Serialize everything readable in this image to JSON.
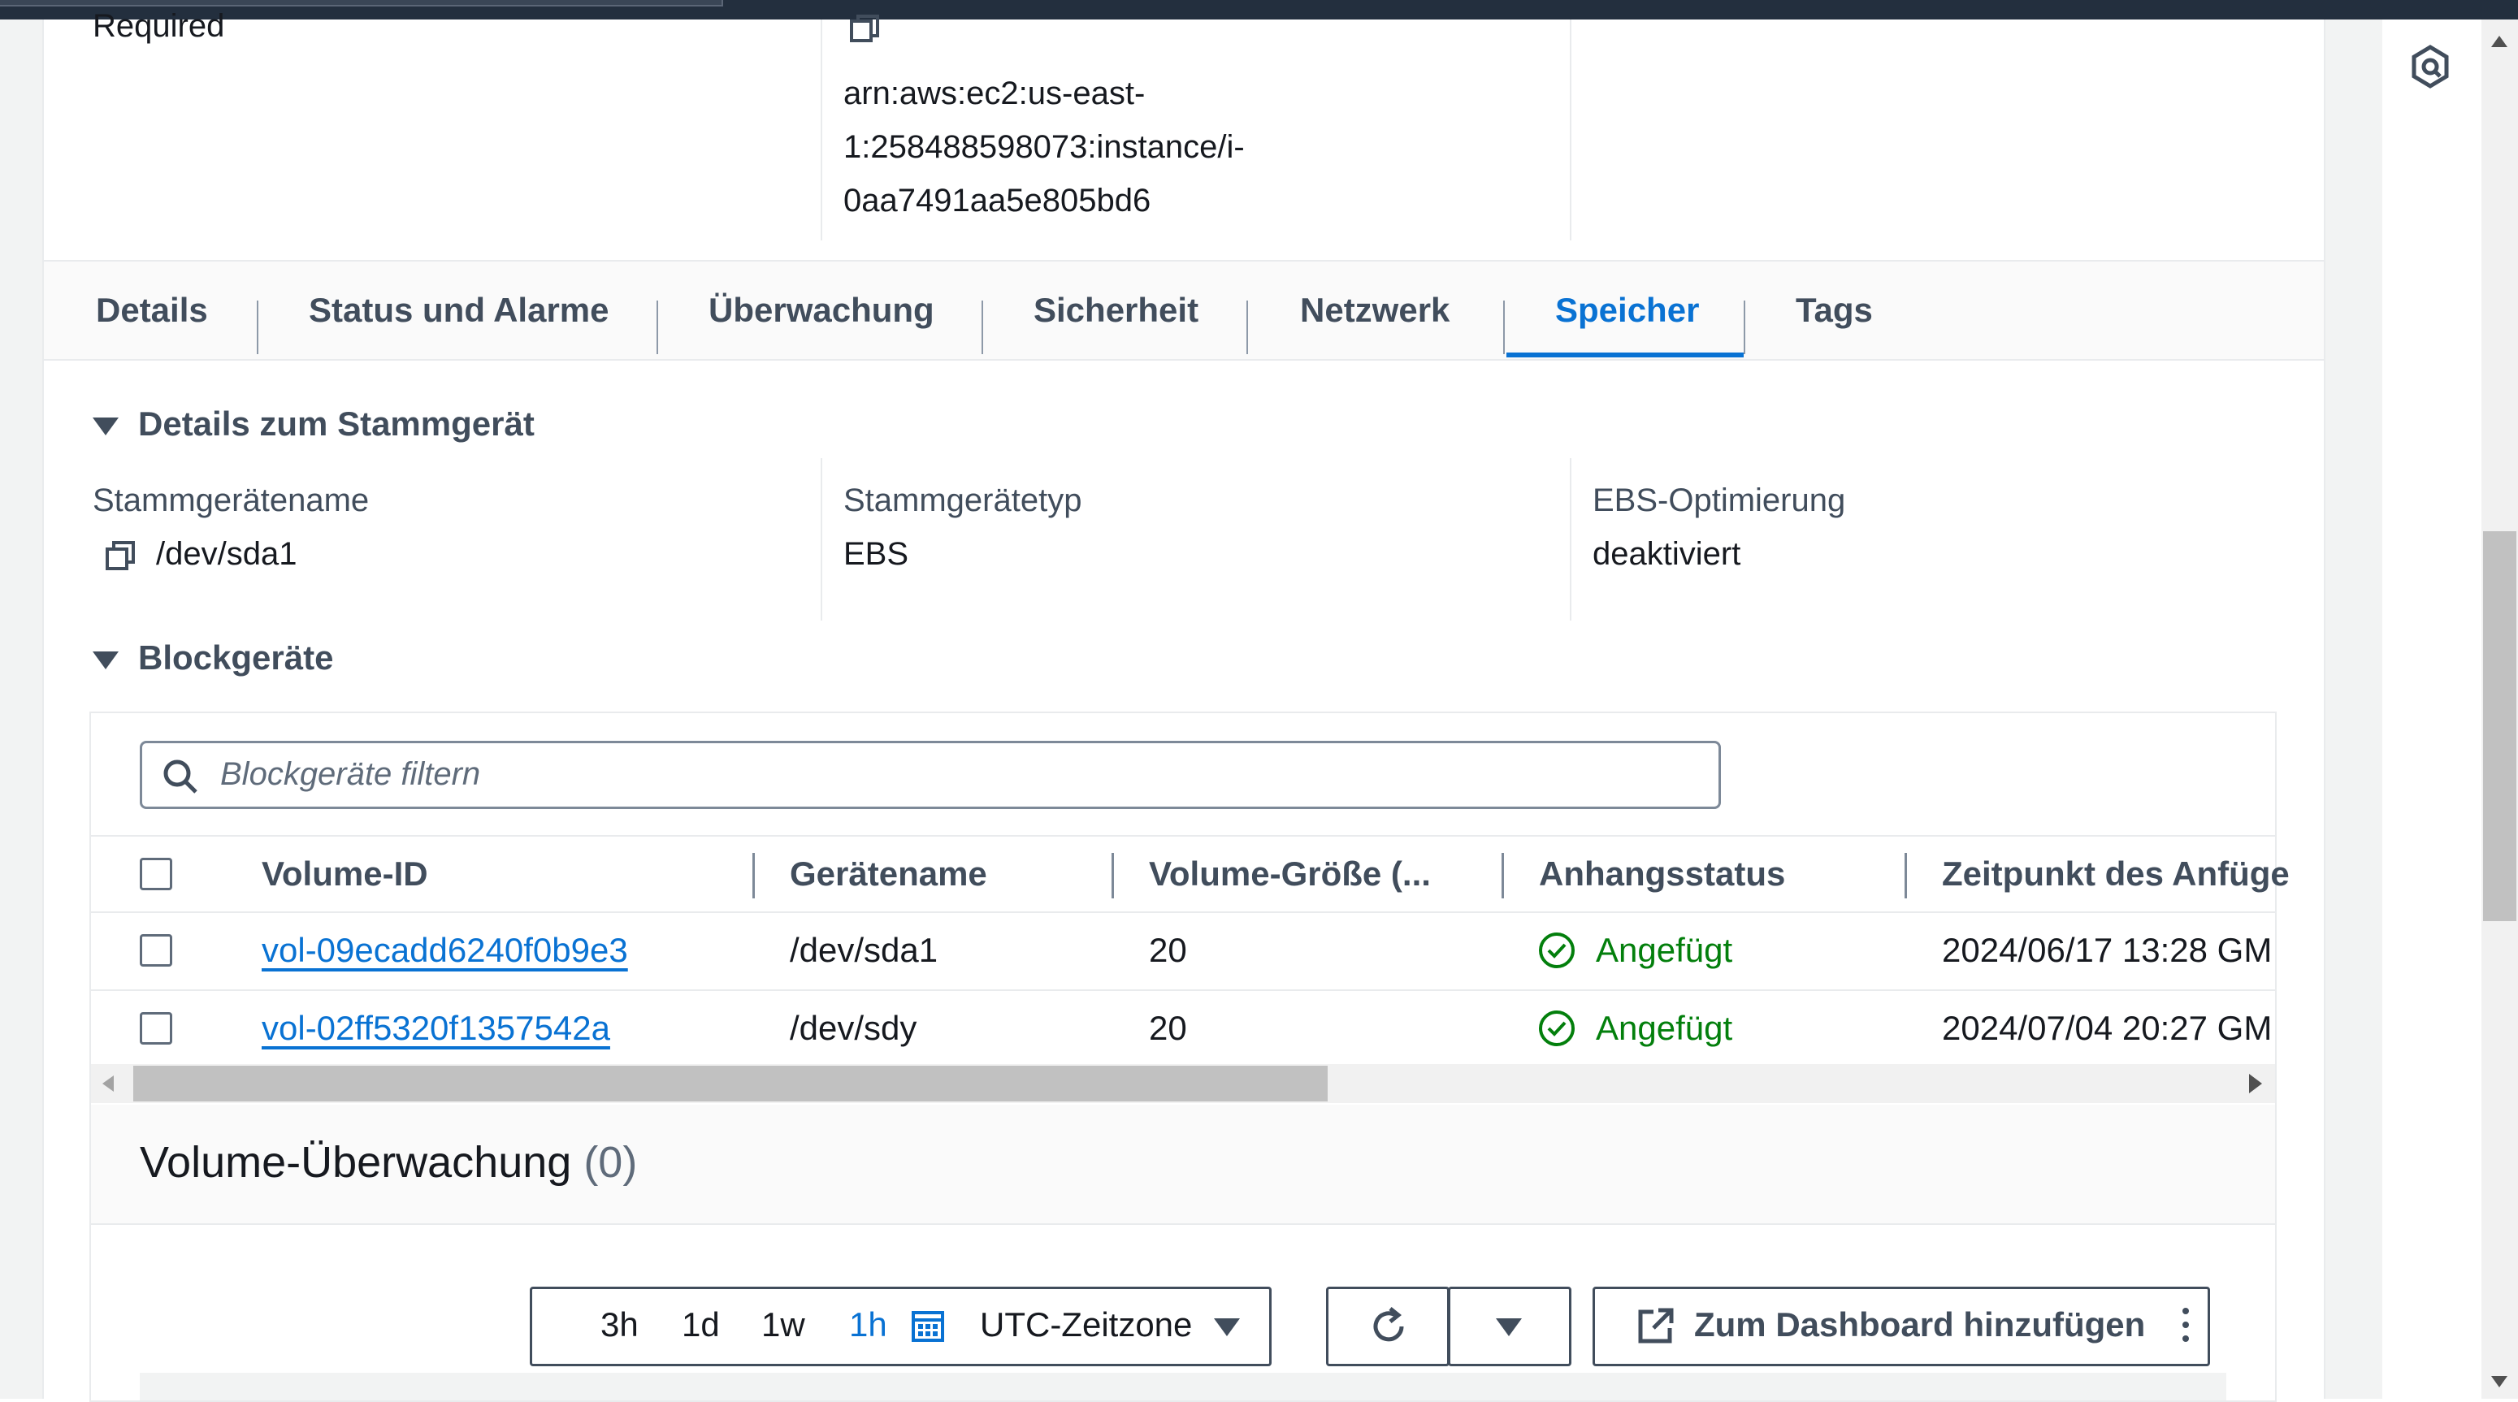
{
  "top": {
    "required_label": "Required",
    "arn_lines": [
      "arn:aws:ec2:us-east-",
      "1:258488598073:instance/i-",
      "0aa7491aa5e805bd6"
    ]
  },
  "tabs": [
    {
      "label": "Details"
    },
    {
      "label": "Status und Alarme"
    },
    {
      "label": "Überwachung"
    },
    {
      "label": "Sicherheit"
    },
    {
      "label": "Netzwerk"
    },
    {
      "label": "Speicher",
      "active": true
    },
    {
      "label": "Tags"
    }
  ],
  "root_device": {
    "heading": "Details zum Stammgerät",
    "fields": [
      {
        "label": "Stammgerätename",
        "value": "/dev/sda1"
      },
      {
        "label": "Stammgerätetyp",
        "value": "EBS"
      },
      {
        "label": "EBS-Optimierung",
        "value": "deaktiviert"
      }
    ]
  },
  "block_devices": {
    "heading": "Blockgeräte",
    "filter_placeholder": "Blockgeräte filtern",
    "columns": [
      "Volume-ID",
      "Gerätename",
      "Volume-Größe (...",
      "Anhangsstatus",
      "Zeitpunkt des Anfüge"
    ],
    "rows": [
      {
        "volume_id": "vol-09ecadd6240f0b9e3",
        "device": "/dev/sda1",
        "size": "20",
        "status": "Angefügt",
        "time": "2024/06/17 13:28 GM"
      },
      {
        "volume_id": "vol-02ff5320f1357542a",
        "device": "/dev/sdy",
        "size": "20",
        "status": "Angefügt",
        "time": "2024/07/04 20:27 GM"
      }
    ]
  },
  "monitoring": {
    "title": "Volume-Überwachung",
    "count": "(0)",
    "ranges": [
      "3h",
      "1d",
      "1w",
      "1h"
    ],
    "selected_range": "1h",
    "timezone": "UTC-Zeitzone",
    "dashboard_button": "Zum Dashboard hinzufügen"
  },
  "colors": {
    "accent": "#0972d3",
    "success": "#037f0c",
    "text": "#16191f",
    "label": "#414d5c"
  }
}
